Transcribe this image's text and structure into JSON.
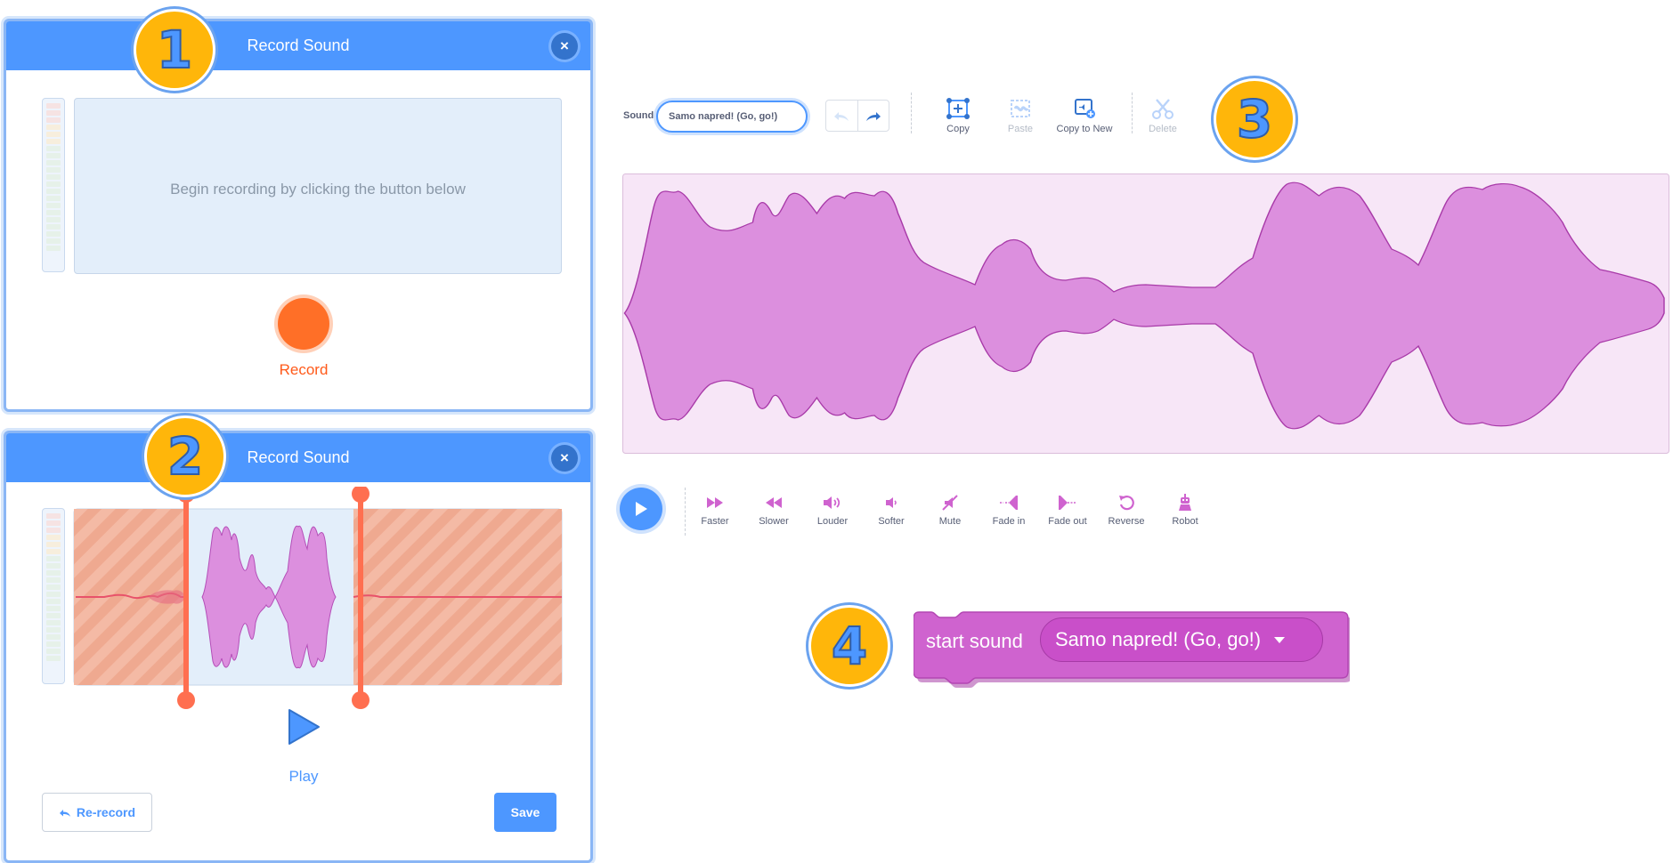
{
  "dialog1": {
    "title": "Record Sound",
    "close_glyph": "×",
    "hint": "Begin recording by clicking the button below",
    "record_label": "Record"
  },
  "dialog2": {
    "title": "Record Sound",
    "close_glyph": "×",
    "play_label": "Play",
    "rerecord_label": "Re-record",
    "save_label": "Save"
  },
  "badges": [
    "1",
    "2",
    "3",
    "4"
  ],
  "editor": {
    "sound_label": "Sound",
    "sound_name": "Samo napred! (Go, go!)",
    "tools": [
      {
        "label": "Copy",
        "icon": "copy-icon",
        "enabled": true
      },
      {
        "label": "Paste",
        "icon": "paste-icon",
        "enabled": false
      },
      {
        "label": "Copy to New",
        "icon": "copy-to-new-icon",
        "enabled": true
      },
      {
        "label": "Delete",
        "icon": "scissors-icon",
        "enabled": false
      }
    ],
    "effects": [
      {
        "label": "Faster",
        "icon": "faster-icon"
      },
      {
        "label": "Slower",
        "icon": "slower-icon"
      },
      {
        "label": "Louder",
        "icon": "louder-icon"
      },
      {
        "label": "Softer",
        "icon": "softer-icon"
      },
      {
        "label": "Mute",
        "icon": "mute-icon"
      },
      {
        "label": "Fade in",
        "icon": "fade-in-icon"
      },
      {
        "label": "Fade out",
        "icon": "fade-out-icon"
      },
      {
        "label": "Reverse",
        "icon": "reverse-icon"
      },
      {
        "label": "Robot",
        "icon": "robot-icon"
      }
    ]
  },
  "block": {
    "label": "start sound",
    "sound_name": "Samo napred! (Go, go!)"
  },
  "colors": {
    "header_blue": "#4d97ff",
    "record_orange": "#ff6f27",
    "sound_purple": "#cf63cf",
    "waveform_fill": "#dc8fde",
    "trim_overlay": "#f0a58a",
    "badge_yellow": "#ffb60a"
  }
}
